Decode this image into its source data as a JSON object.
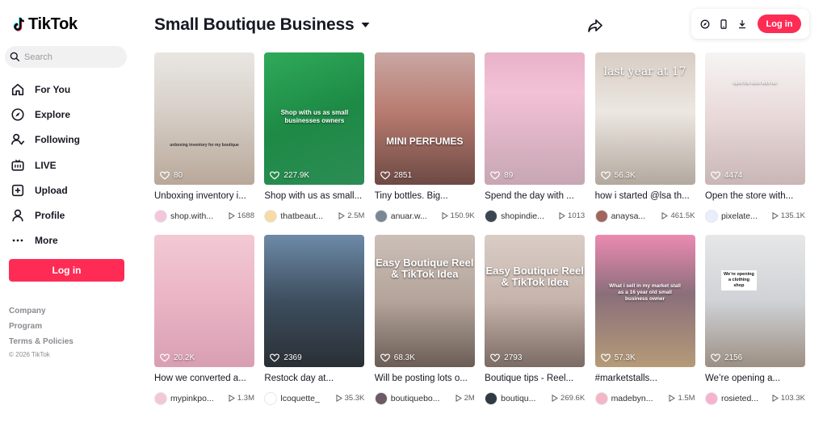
{
  "brand": {
    "name": "TikTok",
    "accent": "#fe2c55"
  },
  "search": {
    "placeholder": "Search"
  },
  "nav": [
    {
      "label": "For You",
      "icon": "home-icon"
    },
    {
      "label": "Explore",
      "icon": "compass-icon"
    },
    {
      "label": "Following",
      "icon": "following-icon"
    },
    {
      "label": "LIVE",
      "icon": "live-icon"
    },
    {
      "label": "Upload",
      "icon": "upload-icon"
    },
    {
      "label": "Profile",
      "icon": "profile-icon"
    },
    {
      "label": "More",
      "icon": "more-icon"
    }
  ],
  "sidebar": {
    "login_label": "Log in",
    "footer": [
      "Company",
      "Program",
      "Terms & Policies"
    ],
    "copyright": "© 2026 TikTok"
  },
  "header": {
    "title": "Small Boutique Business",
    "login_label": "Log in"
  },
  "videos": [
    {
      "views": "80",
      "caption": "Unboxing inventory i...",
      "author": "shop.with...",
      "plays": "1688",
      "overlay": "unboxing inventory for my boutique"
    },
    {
      "views": "227.9K",
      "caption": "Shop with us as small...",
      "author": "thatbeaut...",
      "plays": "2.5M",
      "overlay": "Shop with us as small businesses owners"
    },
    {
      "views": "2851",
      "caption": "Tiny bottles. Big...",
      "author": "anuar.w...",
      "plays": "150.9K",
      "overlay": "MINI PERFUMES"
    },
    {
      "views": "89",
      "caption": "Spend the day with ...",
      "author": "shopindie...",
      "plays": "1013",
      "overlay": ""
    },
    {
      "views": "56.3K",
      "caption": "how i started @lsa th...",
      "author": "anaysa...",
      "plays": "461.5K",
      "overlay": "last year at 17"
    },
    {
      "views": "4474",
      "caption": "Open the store with...",
      "author": "pixelate...",
      "plays": "135.1K",
      "overlay": "open the store with me"
    },
    {
      "views": "20.2K",
      "caption": "How we converted a...",
      "author": "mypinkpo...",
      "plays": "1.3M",
      "overlay": ""
    },
    {
      "views": "2369",
      "caption": "Restock day at...",
      "author": "lcoquette_",
      "plays": "35.3K",
      "overlay": ""
    },
    {
      "views": "68.3K",
      "caption": "Will be posting lots o...",
      "author": "boutiquebo...",
      "plays": "2M",
      "overlay": "Easy Boutique Reel & TikTok Idea"
    },
    {
      "views": "2793",
      "caption": "Boutique tips - Reel...",
      "author": "boutiqu...",
      "plays": "269.6K",
      "overlay": "Easy Boutique Reel & TikTok Idea"
    },
    {
      "views": "57.3K",
      "caption": "#marketstalls...",
      "author": "madebyn...",
      "plays": "1.5M",
      "overlay": "What i sell in my market stall as a 16 year old small business owner"
    },
    {
      "views": "2156",
      "caption": "We’re opening a...",
      "author": "rosieted...",
      "plays": "103.3K",
      "overlay": "We’re opening a clothing shop"
    }
  ]
}
